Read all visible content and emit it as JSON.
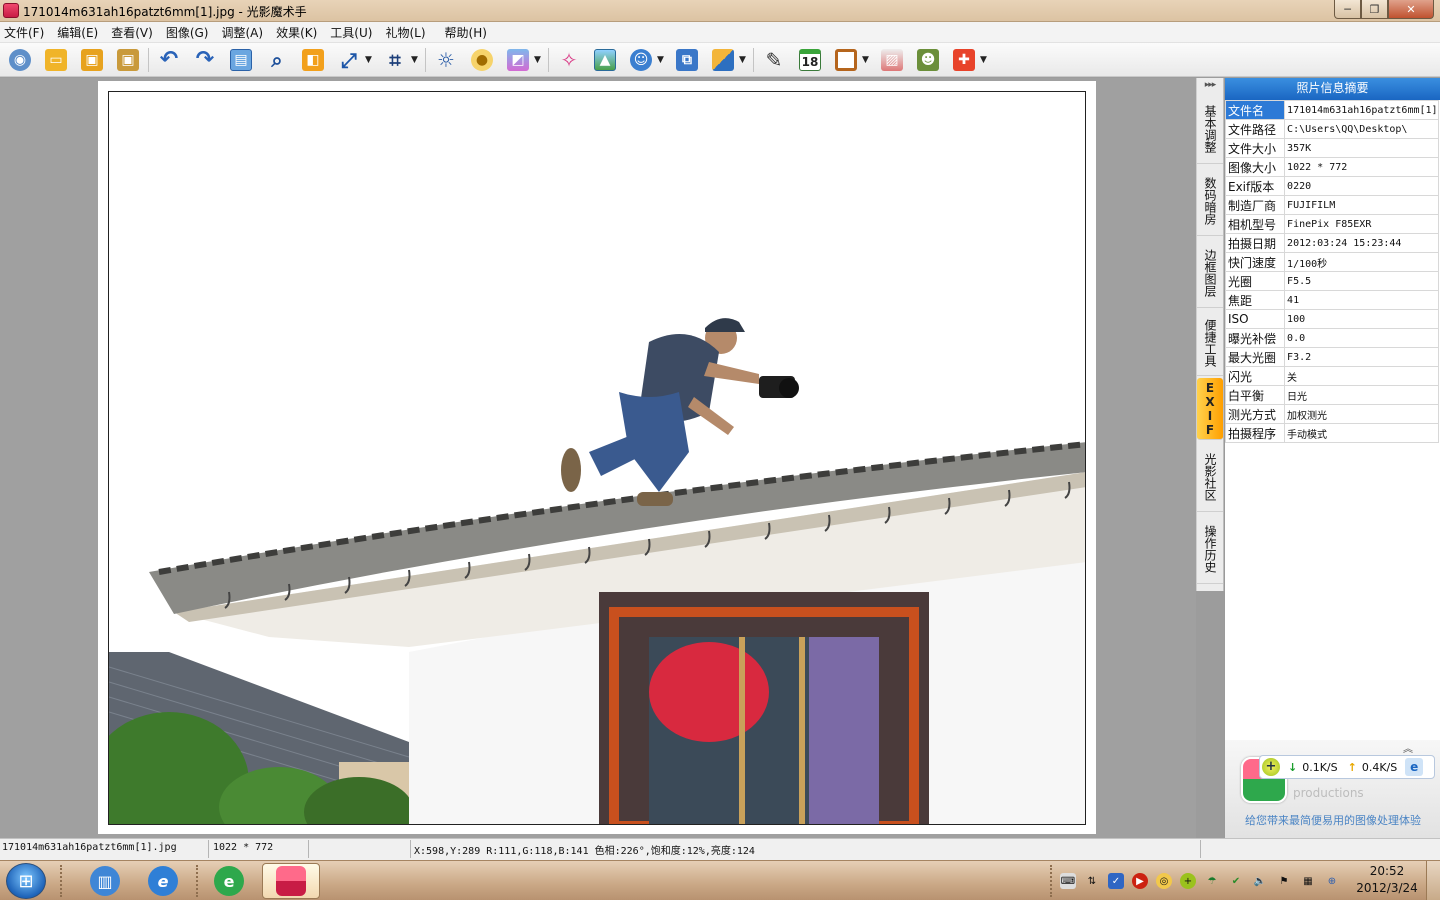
{
  "window": {
    "title": "171014m631ah16patzt6mm[1].jpg - 光影魔术手",
    "minimize": "─",
    "maximize": "❐",
    "close": "✕"
  },
  "menu": [
    "文件(F)",
    "编辑(E)",
    "查看(V)",
    "图像(G)",
    "调整(A)",
    "效果(K)",
    "工具(U)",
    "礼物(L)",
    "帮助(H)"
  ],
  "toolbar_icons": [
    "view-icon",
    "open-icon",
    "save-icon",
    "save-as-icon",
    "undo-icon",
    "redo-icon",
    "compare-icon",
    "zoom-icon",
    "resize-icon",
    "rotate-icon",
    "crop-icon",
    "brightness-icon",
    "auto-level-icon",
    "color-icon",
    "magic-wand-icon",
    "photo-icon",
    "face-icon",
    "batch-icon",
    "curve-icon",
    "pen-tool-icon",
    "calendar-icon",
    "border-icon",
    "collage-icon",
    "portrait-icon",
    "gift-icon"
  ],
  "calendar_day": "18",
  "side_tabs": [
    "基本调整",
    "数码暗房",
    "边框图层",
    "便捷工具",
    "EXIF",
    "光影社区",
    "操作历史"
  ],
  "info_panel": {
    "title": "照片信息摘要",
    "rows": [
      {
        "key": "文件名",
        "value": "171014m631ah16patzt6mm[1]"
      },
      {
        "key": "文件路径",
        "value": "C:\\Users\\QQ\\Desktop\\"
      },
      {
        "key": "文件大小",
        "value": "357K"
      },
      {
        "key": "图像大小",
        "value": "1022 * 772"
      },
      {
        "key": "Exif版本",
        "value": "0220"
      },
      {
        "key": "制造厂商",
        "value": "FUJIFILM"
      },
      {
        "key": "相机型号",
        "value": "FinePix F85EXR"
      },
      {
        "key": "拍摄日期",
        "value": "2012:03:24 15:23:44"
      },
      {
        "key": "快门速度",
        "value": "1/100秒"
      },
      {
        "key": "光圈",
        "value": "F5.5"
      },
      {
        "key": "焦距",
        "value": "41"
      },
      {
        "key": "ISO",
        "value": "100"
      },
      {
        "key": "曝光补偿",
        "value": "0.0"
      },
      {
        "key": "最大光圈",
        "value": "F3.2"
      },
      {
        "key": "闪光",
        "value": "关"
      },
      {
        "key": "白平衡",
        "value": "日光"
      },
      {
        "key": "测光方式",
        "value": "加权测光"
      },
      {
        "key": "拍摄程序",
        "value": "手动模式"
      }
    ]
  },
  "promo": {
    "collapse": "︽",
    "brand": "productions",
    "slogan": "给您带来最简便易用的图像处理体验",
    "net_down": "0.1K/S",
    "net_up": "0.4K/S"
  },
  "status": {
    "filename": "171014m631ah16patzt6mm[1].jpg",
    "size": "1022 * 772",
    "pixel": "X:598,Y:289 R:111,G:118,B:141 色相:226°,饱和度:12%,亮度:124"
  },
  "taskbar": {
    "clock_time": "20:52",
    "clock_date": "2012/3/24"
  }
}
